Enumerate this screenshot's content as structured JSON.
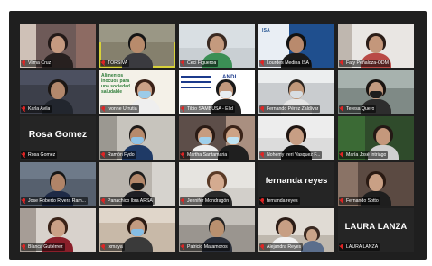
{
  "meeting": {
    "participants": [
      {
        "name": "Vilma Cruz",
        "muted": true
      },
      {
        "name": "TORSIVA",
        "muted": true,
        "speaking": true
      },
      {
        "name": "Ceci Figueroa",
        "muted": true
      },
      {
        "name": "Lourdes Medina ISA",
        "muted": true
      },
      {
        "name": "Faty Peñaloza-ODM",
        "muted": true
      },
      {
        "name": "Karla Avila",
        "muted": true
      },
      {
        "name": "Ivonne Urrutia",
        "muted": true,
        "banner": "Alimentos inocuos para una sociedad saludable"
      },
      {
        "name": "Tibio SAMBUSA - Elid",
        "muted": true,
        "logo": "ANDI"
      },
      {
        "name": "Fernando Pérez Zaldívar",
        "muted": true
      },
      {
        "name": "Teresa Quero",
        "muted": true
      },
      {
        "name": "Rosa Gomez",
        "muted": true,
        "video_off": true,
        "display_name": "Rosa Gomez"
      },
      {
        "name": "Ramón Fydo",
        "muted": true
      },
      {
        "name": "Martha Santamaria",
        "muted": true
      },
      {
        "name": "Nohemy Ireri Vasquez F...",
        "muted": true
      },
      {
        "name": "María José Intriago",
        "muted": true
      },
      {
        "name": "Jose Roberto Rivera Ram...",
        "muted": true
      },
      {
        "name": "Panachico Ibra ARSA",
        "muted": true
      },
      {
        "name": "Jennifer Mondragón",
        "muted": true
      },
      {
        "name": "fernanda reyes",
        "muted": true,
        "video_off": true,
        "display_name": "fernanda reyes"
      },
      {
        "name": "Fernando Sotto",
        "muted": true
      },
      {
        "name": "Blanca Gutiérrez",
        "muted": true
      },
      {
        "name": "Ixmaya",
        "muted": true
      },
      {
        "name": "Patricio Matamoros",
        "muted": true
      },
      {
        "name": "Alejandra Reyes",
        "muted": true
      },
      {
        "name": "LAURA LANZA",
        "muted": true,
        "video_off": true,
        "display_name": "LAURA LANZA"
      }
    ]
  },
  "colors": {
    "frame_bg": "#1f1f1f",
    "active_speaker_border": "#d8d23a",
    "muted_mic": "#e02424"
  }
}
